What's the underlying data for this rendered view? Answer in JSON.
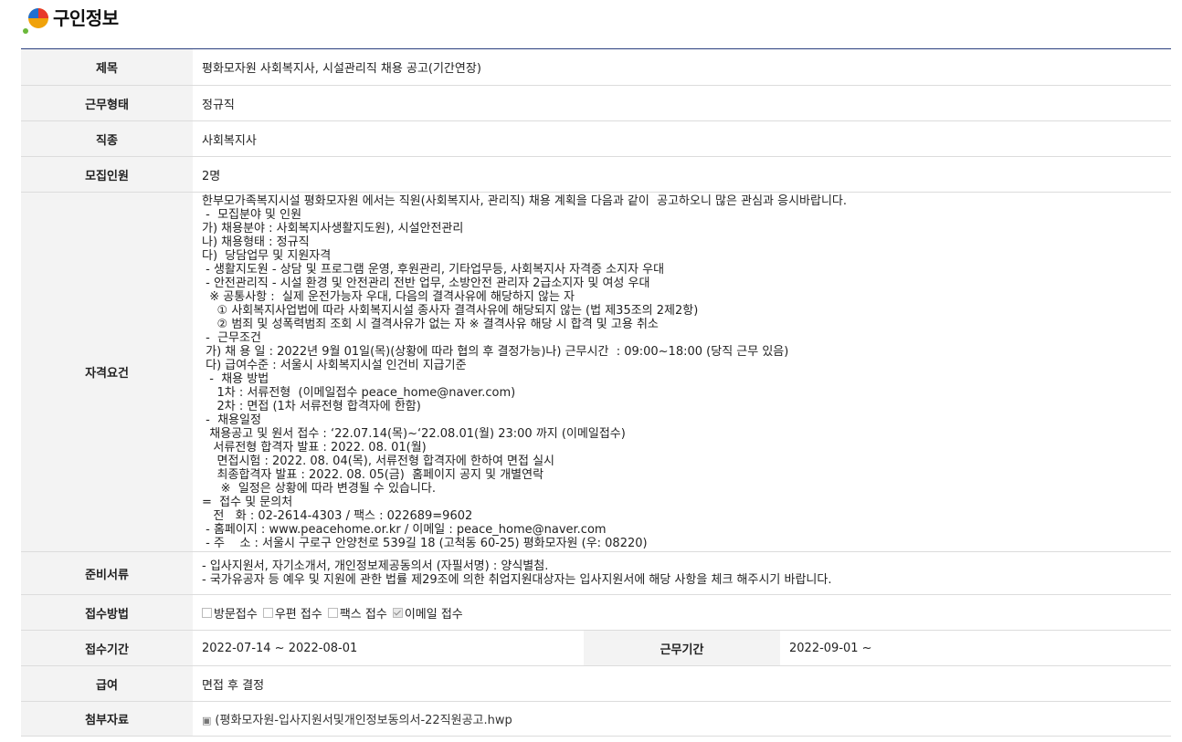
{
  "header": {
    "title": "구인정보",
    "logo_icon": "colorful-dots-logo"
  },
  "fields": {
    "title_label": "제목",
    "title_value": "평화모자원 사회복지사, 시설관리직 채용 공고(기간연장)",
    "worktype_label": "근무형태",
    "worktype_value": "정규직",
    "job_label": "직종",
    "job_value": "사회복지사",
    "recruit_label": "모집인원",
    "recruit_value": "2명",
    "qual_label": "자격요건",
    "qual_lines": [
      "한부모가족복지시설 평화모자원 에서는 직원(사회복지사, 관리직) 채용 계획을 다음과 같이  공고하오니 많은 관심과 응시바랍니다.",
      " -  모집분야 및 인원",
      "가) 채용분야 : 사회복지사생활지도원), 시설안전관리",
      "나) 채용형태 : 정규직",
      "다)  당담업무 및 지원자격",
      " - 생활지도원 - 상담 및 프로그램 운영, 후원관리, 기타업무등, 사회복지사 자격증 소지자 우대",
      " - 안전관리직 - 시설 환경 및 안전관리 전반 업무, 소방안전 관리자 2급소지자 및 여성 우대",
      "  ※ 공통사항 :  실제 운전가능자 우대, 다음의 결격사유에 해당하지 않는 자",
      "    ① 사회복지사업법에 따라 사회복지시설 종사자 결격사유에 해당되지 않는 (법 제35조의 2제2항)",
      "    ② 범죄 및 성폭력범죄 조회 시 결격사유가 없는 자 ※ 결격사유 해당 시 합격 및 고용 취소",
      " -  근무조건",
      " 가) 채 용 일 : 2022년 9월 01일(목)(상황에 따라 협의 후 결정가능)나) 근무시간  : 09:00~18:00 (당직 근무 있음)",
      " 다) 급여수준 : 서울시 사회복지시설 인건비 지급기준",
      "  -  채용 방법",
      "    1차 : 서류전형  (이메일접수 peace_home@naver.com)",
      "    2차 : 면접 (1차 서류전형 합격자에 한함)",
      " -  채용일정",
      "  채용공고 및 원서 접수 : ‘22.07.14(목)~‘22.08.01(월) 23:00 까지 (이메일접수)",
      "   서류전형 합격자 발표 : 2022. 08. 01(월)",
      "    면접시험 : 2022. 08. 04(목), 서류전형 합격자에 한하여 면접 실시",
      "    최종합격자 발표 : 2022. 08. 05(금)  홈페이지 공지 및 개별연락",
      "     ※  일정은 상황에 따라 변경될 수 있습니다.",
      "=  접수 및 문의처",
      "   전   화 : 02-2614-4303 / 팩스 : 022689=9602",
      " - 홈페이지 : www.peacehome.or.kr / 이메일 : peace_home@naver.com",
      " - 주    소 : 서울시 구로구 안양천로 539길 18 (고척동 60-25) 평화모자원 (우: 08220)"
    ],
    "docs_label": "준비서류",
    "docs_lines": [
      "- 입사지원서, 자기소개서, 개인정보제공동의서 (자필서명) : 양식별첨.",
      "- 국가유공자 등 예우 및 지원에 관한 법률 제29조에 의한 취업지원대상자는 입사지원서에 해당 사항을 체크 해주시기 바랍니다."
    ],
    "method_label": "접수방법",
    "methods": [
      {
        "label": "방문접수",
        "checked": false
      },
      {
        "label": "우편 접수",
        "checked": false
      },
      {
        "label": "팩스 접수",
        "checked": false
      },
      {
        "label": "이메일 접수",
        "checked": true
      }
    ],
    "period_label": "접수기간",
    "period_value": "2022-07-14 ~ 2022-08-01",
    "workperiod_label": "근무기간",
    "workperiod_value": "2022-09-01 ~",
    "salary_label": "급여",
    "salary_value": "면접 후 결정",
    "attach_label": "첨부자료",
    "attach_value": "(평화모자원-입사지원서및개인정보동의서-22직원공고.hwp",
    "attach_icon": "file-icon"
  },
  "colors": {
    "header_line": "#2b3f7e",
    "label_bg": "#f3f3f3",
    "border": "#dcdcdc"
  }
}
